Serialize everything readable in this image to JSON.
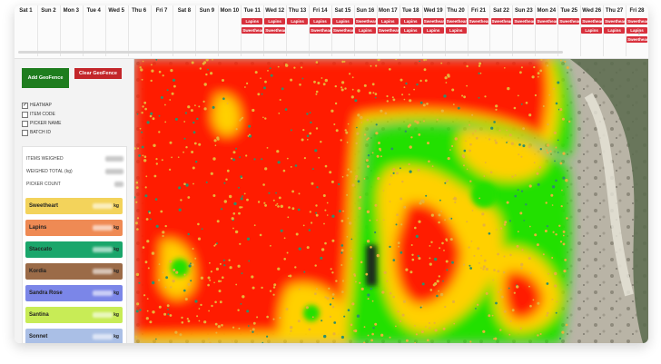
{
  "timeline": {
    "days": [
      {
        "label": "Sat 1",
        "chips": []
      },
      {
        "label": "Sun 2",
        "chips": []
      },
      {
        "label": "Mon 3",
        "chips": []
      },
      {
        "label": "Tue 4",
        "chips": []
      },
      {
        "label": "Wed 5",
        "chips": []
      },
      {
        "label": "Thu 6",
        "chips": []
      },
      {
        "label": "Fri 7",
        "chips": []
      },
      {
        "label": "Sat 8",
        "chips": []
      },
      {
        "label": "Sun 9",
        "chips": []
      },
      {
        "label": "Mon 10",
        "chips": []
      },
      {
        "label": "Tue 11",
        "chips": [
          "Lapins",
          "Sweetheart"
        ]
      },
      {
        "label": "Wed 12",
        "chips": [
          "Lapins",
          "Sweetheart"
        ]
      },
      {
        "label": "Thu 13",
        "chips": [
          "Lapins"
        ]
      },
      {
        "label": "Fri 14",
        "chips": [
          "Lapins",
          "Sweetheart"
        ]
      },
      {
        "label": "Sat 15",
        "chips": [
          "Lapins",
          "Sweetheart"
        ]
      },
      {
        "label": "Sun 16",
        "chips": [
          "Sweetheart",
          "Lapins"
        ]
      },
      {
        "label": "Mon 17",
        "chips": [
          "Lapins",
          "Sweetheart"
        ]
      },
      {
        "label": "Tue 18",
        "chips": [
          "Lapins",
          "Lapins"
        ]
      },
      {
        "label": "Wed 19",
        "chips": [
          "Sweetheart",
          "Lapins"
        ]
      },
      {
        "label": "Thu 20",
        "chips": [
          "Sweetheart",
          "Lapins"
        ]
      },
      {
        "label": "Fri 21",
        "chips": [
          "Sweetheart"
        ]
      },
      {
        "label": "Sat 22",
        "chips": [
          "Sweetheart"
        ]
      },
      {
        "label": "Sun 23",
        "chips": [
          "Sweetheart"
        ]
      },
      {
        "label": "Mon 24",
        "chips": [
          "Sweetheart"
        ]
      },
      {
        "label": "Tue 25",
        "chips": [
          "Sweetheart"
        ]
      },
      {
        "label": "Wed 26",
        "chips": [
          "Sweetheart",
          "Lapins"
        ]
      },
      {
        "label": "Thu 27",
        "chips": [
          "Sweetheart",
          "Lapins"
        ]
      },
      {
        "label": "Fri 28",
        "chips": [
          "Sweetheart",
          "Lapins",
          "Sweetheart"
        ]
      }
    ]
  },
  "sidebar": {
    "add_geofence": "Add GeoFence",
    "clear_geofence": "Clear GeoFence",
    "layers": [
      {
        "label": "HEATMAP",
        "checked": true
      },
      {
        "label": "ITEM CODE",
        "checked": false
      },
      {
        "label": "PICKER NAME",
        "checked": false
      },
      {
        "label": "BATCH ID",
        "checked": false
      }
    ],
    "stats": {
      "items_weighed": "ITEMS WEIGHED",
      "weighed_total": "WEIGHED TOTAL (kg)",
      "picker_count": "PICKER COUNT"
    },
    "varieties": [
      {
        "name": "Sweetheart",
        "unit": "kg",
        "color": "#f3d35b"
      },
      {
        "name": "Lapins",
        "unit": "kg",
        "color": "#ef8a54"
      },
      {
        "name": "Staccato",
        "unit": "kg",
        "color": "#1aa66b"
      },
      {
        "name": "Kordia",
        "unit": "kg",
        "color": "#9b6b48"
      },
      {
        "name": "Sandra Rose",
        "unit": "kg",
        "color": "#7b86e8"
      },
      {
        "name": "Santina",
        "unit": "kg",
        "color": "#c8ec56"
      },
      {
        "name": "Sonnet",
        "unit": "kg",
        "color": "#aabfe6"
      }
    ]
  },
  "colors": {
    "heat_hot": "#ff1a00",
    "heat_warm": "#ffd000",
    "heat_cool": "#22e000",
    "marker": "#e8b23a",
    "marker_alt": "#2f8f6a"
  }
}
